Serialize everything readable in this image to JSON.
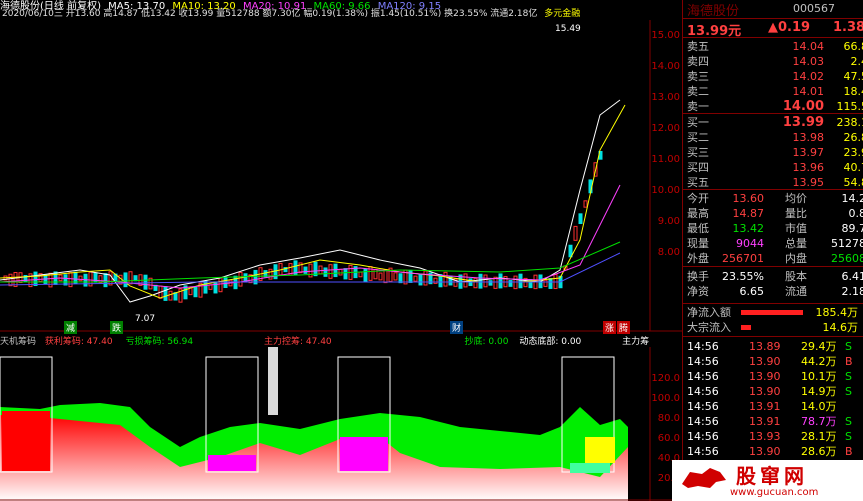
{
  "header": {
    "stock": "海德股份(日线 前复权)",
    "ma5": "MA5: 13.70",
    "ma10": "MA10: 13.20",
    "ma20": "MA20: 10.91",
    "ma60": "MA60: 9.66",
    "ma120": "MA120: 9.15",
    "info": "2020/06/10三 开13.60 高14.87 低13.42 收13.99 量512788 额7.30亿 幅0.19(1.38%) 振1.45(10.51%) 换23.55% 流通2.18亿",
    "tag": "多元金融"
  },
  "price_axis": [
    "15.00",
    "14.00",
    "13.00",
    "12.00",
    "11.00",
    "10.00",
    "9.00",
    "8.00"
  ],
  "chart_labels": {
    "high": "15.49",
    "low": "7.07"
  },
  "bottom_markers": {
    "m1": "减",
    "m2": "跌",
    "m3": "财",
    "m4": "涨",
    "m5": "腾"
  },
  "indicator": {
    "name": "天机筹码",
    "profit": "获利筹码: 47.40",
    "loss": "亏损筹码: 56.94",
    "main": "主力控筹: 47.40",
    "bottom": "抄底: 0.00",
    "dyn": "动态底部: 0.00",
    "main2": "主力筹",
    "axis": [
      "120.0",
      "100.0",
      "80.0",
      "60.0",
      "40.0",
      "20.0"
    ]
  },
  "panel": {
    "name": "海德股份",
    "code": "000567",
    "price": "13.99元",
    "change": "▲0.19",
    "pct": "1.38",
    "asks": [
      {
        "label": "卖五",
        "price": "14.04",
        "vol": "66.8"
      },
      {
        "label": "卖四",
        "price": "14.03",
        "vol": "2.4"
      },
      {
        "label": "卖三",
        "price": "14.02",
        "vol": "47.5"
      },
      {
        "label": "卖二",
        "price": "14.01",
        "vol": "18.4"
      },
      {
        "label": "卖一",
        "price": "14.00",
        "vol": "115.5"
      }
    ],
    "bids": [
      {
        "label": "买一",
        "price": "13.99",
        "vol": "238.1"
      },
      {
        "label": "买二",
        "price": "13.98",
        "vol": "26.8"
      },
      {
        "label": "买三",
        "price": "13.97",
        "vol": "23.9"
      },
      {
        "label": "买四",
        "price": "13.96",
        "vol": "40.7"
      },
      {
        "label": "买五",
        "price": "13.95",
        "vol": "54.8"
      }
    ],
    "stats": [
      {
        "l1": "今开",
        "v1": "13.60",
        "l2": "均价",
        "v2": "14.2"
      },
      {
        "l1": "最高",
        "v1": "14.87",
        "l2": "量比",
        "v2": "0.8"
      },
      {
        "l1": "最低",
        "v1": "13.42",
        "l2": "市值",
        "v2": "89.7"
      },
      {
        "l1": "现量",
        "v1": "9044",
        "l2": "总量",
        "v2": "51278"
      },
      {
        "l1": "外盘",
        "v1": "256701",
        "l2": "内盘",
        "v2": "25608"
      }
    ],
    "stats2": [
      {
        "l1": "换手",
        "v1": "23.55%",
        "l2": "股本",
        "v2": "6.41"
      },
      {
        "l1": "净资",
        "v1": "6.65",
        "l2": "流通",
        "v2": "2.18"
      }
    ],
    "flow": [
      {
        "label": "净流入额",
        "val": "185.4万"
      },
      {
        "label": "大宗流入",
        "val": "14.6万"
      }
    ],
    "ticks": [
      {
        "t": "14:56",
        "p": "13.89",
        "v": "29.4万",
        "s": "S"
      },
      {
        "t": "14:56",
        "p": "13.90",
        "v": "44.2万",
        "s": "B"
      },
      {
        "t": "14:56",
        "p": "13.90",
        "v": "10.1万",
        "s": "S"
      },
      {
        "t": "14:56",
        "p": "13.90",
        "v": "14.9万",
        "s": "S"
      },
      {
        "t": "14:56",
        "p": "13.91",
        "v": "14.0万",
        "s": ""
      },
      {
        "t": "14:56",
        "p": "13.91",
        "v": "78.7万",
        "s": "S"
      },
      {
        "t": "14:56",
        "p": "13.93",
        "v": "28.1万",
        "s": "S"
      },
      {
        "t": "14:56",
        "p": "13.90",
        "v": "28.6万",
        "s": "B"
      }
    ]
  },
  "watermark": {
    "title": "股窜网",
    "url": "www.gucuan.com"
  },
  "colors": {
    "up": "#ff3030",
    "down": "#00e0e0",
    "bg": "#000000",
    "accent": "#ffff00"
  }
}
